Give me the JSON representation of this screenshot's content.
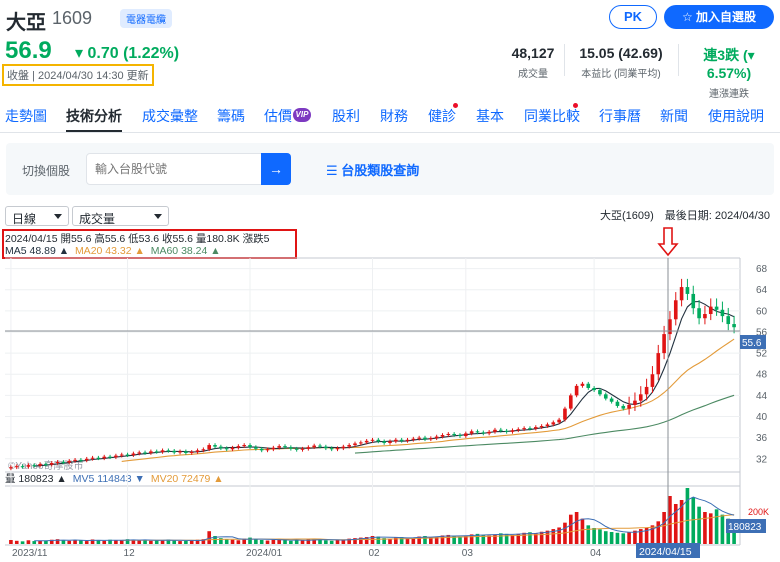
{
  "header": {
    "name": "大亞",
    "code": "1609",
    "tag": "電器電纜",
    "pk_label": "PK",
    "add_label": "加入自選股",
    "price": "56.9",
    "change": "0.70 (1.22%)",
    "status": "收盤 | 2024/04/30 14:30 更新",
    "stats": [
      {
        "value": "48,127",
        "label": "成交量"
      },
      {
        "value": "15.05 (42.69)",
        "label": "本益比 (同業平均)"
      },
      {
        "value": "連3跌 (▾ 6.57%)",
        "label": "連漲連跌"
      }
    ]
  },
  "nav": {
    "tabs": [
      "走勢圖",
      "技術分析",
      "成交彙整",
      "籌碼",
      "估價",
      "股利",
      "財務",
      "健診",
      "基本",
      "同業比較",
      "行事曆",
      "新聞",
      "使用說明"
    ],
    "vip": "VIP"
  },
  "switcher": {
    "label": "切換個股",
    "placeholder": "輸入台股代號",
    "category_link": "台股類股查詢"
  },
  "controls": {
    "period": "日線",
    "indicator": "成交量",
    "symbol_info": "大亞(1609)　最後日期: 2024/04/30"
  },
  "info": {
    "ohlc": "2024/04/15 開55.6 高55.6 低53.6 收55.6 量180.8K 漲跌5",
    "ma5": "MA5 48.89 ▲",
    "ma20": "MA20 43.32 ▲",
    "ma60": "MA60 38.24 ▲",
    "watermark": "©Yahoo奇摩股市",
    "vol": "量 180823 ▲",
    "mv5": "MV5 114843 ▼",
    "mv20": "MV20 72479 ▲",
    "crosshair_price": "55.6",
    "crosshair_vol": "180823",
    "crosshair_date": "2024/04/15"
  },
  "colors": {
    "up": "#e01414",
    "down": "#00ab5e",
    "ma5": "#22313f",
    "ma20": "#e39b3a",
    "ma60": "#4c8a63",
    "accent": "#0f69ff"
  },
  "chart_data": {
    "type": "candlestick",
    "y_ticks": [
      32,
      36,
      40,
      44,
      48,
      52,
      56,
      60,
      64,
      68
    ],
    "vol_tick": "200K",
    "x_labels": [
      "2023/11",
      "12",
      "2024/01",
      "02",
      "03",
      "04"
    ],
    "candles_o": [
      30.2,
      30.4,
      30.6,
      30.5,
      30.8,
      30.7,
      31.0,
      30.9,
      31.2,
      31.4,
      31.3,
      31.6,
      31.8,
      31.7,
      32.0,
      32.2,
      32.1,
      32.4,
      32.3,
      32.6,
      32.8,
      32.7,
      33.0,
      33.2,
      33.1,
      33.4,
      33.3,
      33.6,
      33.5,
      33.2,
      33.4,
      33.1,
      33.3,
      33.6,
      33.8,
      34.6,
      34.3,
      34.0,
      33.8,
      34.1,
      34.4,
      34.6,
      34.2,
      33.9,
      33.6,
      33.8,
      34.1,
      34.4,
      34.2,
      33.9,
      33.7,
      33.9,
      34.2,
      34.5,
      34.3,
      34.0,
      33.8,
      34.0,
      34.3,
      34.6,
      34.9,
      35.1,
      35.4,
      35.6,
      35.3,
      35.0,
      35.3,
      35.6,
      35.4,
      35.6,
      35.8,
      36.0,
      35.7,
      35.9,
      36.2,
      36.5,
      36.7,
      36.5,
      36.3,
      36.8,
      37.2,
      37.0,
      36.8,
      37.1,
      37.5,
      37.3,
      37.1,
      37.4,
      37.6,
      37.8,
      37.7,
      38.0,
      38.2,
      38.5,
      38.9,
      39.4,
      41.5,
      44.0,
      45.8,
      46.2,
      45.4,
      45.0,
      44.2,
      43.4,
      42.8,
      42.0,
      41.5,
      42.2,
      43.0,
      44.2,
      45.6,
      48.0,
      52.0,
      55.6,
      58.4,
      62.0,
      64.5,
      63.2,
      60.5,
      58.6,
      59.4,
      60.8,
      60.2,
      59.0,
      57.5
    ],
    "candles_c": [
      30.4,
      30.6,
      30.5,
      30.8,
      30.7,
      31.0,
      30.9,
      31.2,
      31.4,
      31.3,
      31.6,
      31.8,
      31.7,
      32.0,
      32.2,
      32.1,
      32.4,
      32.3,
      32.6,
      32.8,
      32.7,
      33.0,
      33.2,
      33.1,
      33.4,
      33.3,
      33.6,
      33.5,
      33.2,
      33.4,
      33.1,
      33.3,
      33.6,
      33.8,
      34.6,
      34.3,
      34.0,
      33.8,
      34.1,
      34.4,
      34.6,
      34.2,
      33.9,
      33.6,
      33.8,
      34.1,
      34.4,
      34.2,
      33.9,
      33.7,
      33.9,
      34.2,
      34.5,
      34.3,
      34.0,
      33.8,
      34.0,
      34.3,
      34.6,
      34.9,
      35.1,
      35.4,
      35.6,
      35.3,
      35.0,
      35.3,
      35.6,
      35.4,
      35.6,
      35.8,
      36.0,
      35.7,
      35.9,
      36.2,
      36.5,
      36.7,
      36.5,
      36.3,
      36.8,
      37.2,
      37.0,
      36.8,
      37.1,
      37.5,
      37.3,
      37.1,
      37.4,
      37.6,
      37.8,
      37.7,
      38.0,
      38.2,
      38.5,
      38.9,
      39.4,
      41.5,
      44.0,
      45.8,
      46.2,
      45.4,
      45.0,
      44.2,
      43.4,
      42.8,
      42.0,
      41.5,
      42.2,
      43.0,
      44.2,
      45.6,
      48.0,
      52.0,
      55.6,
      58.4,
      62.0,
      64.5,
      63.2,
      60.5,
      58.6,
      59.4,
      60.8,
      60.2,
      59.0,
      57.5,
      56.9
    ],
    "volumes": [
      15,
      12,
      10,
      14,
      11,
      13,
      12,
      16,
      18,
      14,
      12,
      15,
      13,
      11,
      17,
      14,
      12,
      16,
      13,
      15,
      18,
      14,
      13,
      16,
      12,
      15,
      14,
      17,
      13,
      11,
      12,
      14,
      16,
      18,
      48,
      30,
      22,
      18,
      16,
      14,
      20,
      24,
      18,
      15,
      13,
      16,
      18,
      15,
      12,
      14,
      13,
      17,
      19,
      16,
      14,
      12,
      15,
      17,
      20,
      22,
      24,
      26,
      30,
      28,
      22,
      20,
      24,
      26,
      22,
      24,
      28,
      30,
      26,
      28,
      32,
      34,
      30,
      28,
      32,
      36,
      38,
      34,
      32,
      36,
      40,
      38,
      34,
      38,
      42,
      44,
      40,
      46,
      50,
      56,
      62,
      80,
      110,
      120,
      95,
      70,
      60,
      55,
      48,
      45,
      42,
      40,
      44,
      50,
      56,
      62,
      70,
      85,
      120,
      180,
      150,
      165,
      210,
      175,
      140,
      120,
      115,
      130,
      110,
      95,
      90
    ]
  }
}
